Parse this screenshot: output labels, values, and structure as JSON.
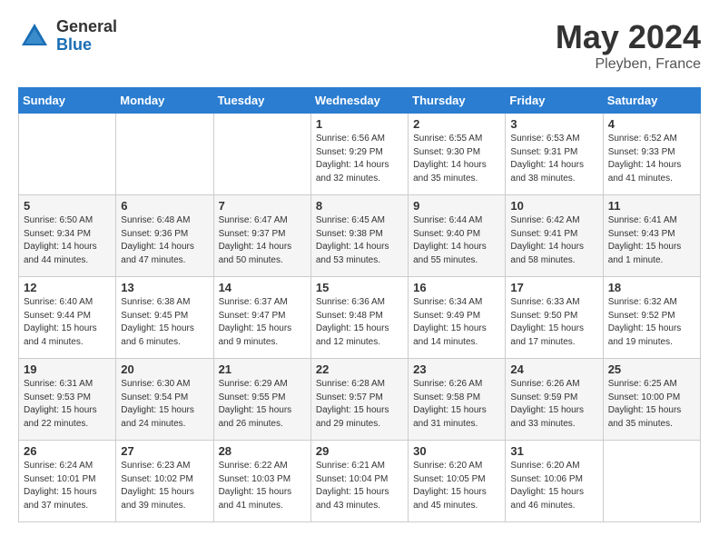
{
  "logo": {
    "general": "General",
    "blue": "Blue"
  },
  "title": {
    "month_year": "May 2024",
    "location": "Pleyben, France"
  },
  "calendar": {
    "headers": [
      "Sunday",
      "Monday",
      "Tuesday",
      "Wednesday",
      "Thursday",
      "Friday",
      "Saturday"
    ],
    "weeks": [
      [
        {
          "day": "",
          "info": ""
        },
        {
          "day": "",
          "info": ""
        },
        {
          "day": "",
          "info": ""
        },
        {
          "day": "1",
          "info": "Sunrise: 6:56 AM\nSunset: 9:29 PM\nDaylight: 14 hours\nand 32 minutes."
        },
        {
          "day": "2",
          "info": "Sunrise: 6:55 AM\nSunset: 9:30 PM\nDaylight: 14 hours\nand 35 minutes."
        },
        {
          "day": "3",
          "info": "Sunrise: 6:53 AM\nSunset: 9:31 PM\nDaylight: 14 hours\nand 38 minutes."
        },
        {
          "day": "4",
          "info": "Sunrise: 6:52 AM\nSunset: 9:33 PM\nDaylight: 14 hours\nand 41 minutes."
        }
      ],
      [
        {
          "day": "5",
          "info": "Sunrise: 6:50 AM\nSunset: 9:34 PM\nDaylight: 14 hours\nand 44 minutes."
        },
        {
          "day": "6",
          "info": "Sunrise: 6:48 AM\nSunset: 9:36 PM\nDaylight: 14 hours\nand 47 minutes."
        },
        {
          "day": "7",
          "info": "Sunrise: 6:47 AM\nSunset: 9:37 PM\nDaylight: 14 hours\nand 50 minutes."
        },
        {
          "day": "8",
          "info": "Sunrise: 6:45 AM\nSunset: 9:38 PM\nDaylight: 14 hours\nand 53 minutes."
        },
        {
          "day": "9",
          "info": "Sunrise: 6:44 AM\nSunset: 9:40 PM\nDaylight: 14 hours\nand 55 minutes."
        },
        {
          "day": "10",
          "info": "Sunrise: 6:42 AM\nSunset: 9:41 PM\nDaylight: 14 hours\nand 58 minutes."
        },
        {
          "day": "11",
          "info": "Sunrise: 6:41 AM\nSunset: 9:43 PM\nDaylight: 15 hours\nand 1 minute."
        }
      ],
      [
        {
          "day": "12",
          "info": "Sunrise: 6:40 AM\nSunset: 9:44 PM\nDaylight: 15 hours\nand 4 minutes."
        },
        {
          "day": "13",
          "info": "Sunrise: 6:38 AM\nSunset: 9:45 PM\nDaylight: 15 hours\nand 6 minutes."
        },
        {
          "day": "14",
          "info": "Sunrise: 6:37 AM\nSunset: 9:47 PM\nDaylight: 15 hours\nand 9 minutes."
        },
        {
          "day": "15",
          "info": "Sunrise: 6:36 AM\nSunset: 9:48 PM\nDaylight: 15 hours\nand 12 minutes."
        },
        {
          "day": "16",
          "info": "Sunrise: 6:34 AM\nSunset: 9:49 PM\nDaylight: 15 hours\nand 14 minutes."
        },
        {
          "day": "17",
          "info": "Sunrise: 6:33 AM\nSunset: 9:50 PM\nDaylight: 15 hours\nand 17 minutes."
        },
        {
          "day": "18",
          "info": "Sunrise: 6:32 AM\nSunset: 9:52 PM\nDaylight: 15 hours\nand 19 minutes."
        }
      ],
      [
        {
          "day": "19",
          "info": "Sunrise: 6:31 AM\nSunset: 9:53 PM\nDaylight: 15 hours\nand 22 minutes."
        },
        {
          "day": "20",
          "info": "Sunrise: 6:30 AM\nSunset: 9:54 PM\nDaylight: 15 hours\nand 24 minutes."
        },
        {
          "day": "21",
          "info": "Sunrise: 6:29 AM\nSunset: 9:55 PM\nDaylight: 15 hours\nand 26 minutes."
        },
        {
          "day": "22",
          "info": "Sunrise: 6:28 AM\nSunset: 9:57 PM\nDaylight: 15 hours\nand 29 minutes."
        },
        {
          "day": "23",
          "info": "Sunrise: 6:26 AM\nSunset: 9:58 PM\nDaylight: 15 hours\nand 31 minutes."
        },
        {
          "day": "24",
          "info": "Sunrise: 6:26 AM\nSunset: 9:59 PM\nDaylight: 15 hours\nand 33 minutes."
        },
        {
          "day": "25",
          "info": "Sunrise: 6:25 AM\nSunset: 10:00 PM\nDaylight: 15 hours\nand 35 minutes."
        }
      ],
      [
        {
          "day": "26",
          "info": "Sunrise: 6:24 AM\nSunset: 10:01 PM\nDaylight: 15 hours\nand 37 minutes."
        },
        {
          "day": "27",
          "info": "Sunrise: 6:23 AM\nSunset: 10:02 PM\nDaylight: 15 hours\nand 39 minutes."
        },
        {
          "day": "28",
          "info": "Sunrise: 6:22 AM\nSunset: 10:03 PM\nDaylight: 15 hours\nand 41 minutes."
        },
        {
          "day": "29",
          "info": "Sunrise: 6:21 AM\nSunset: 10:04 PM\nDaylight: 15 hours\nand 43 minutes."
        },
        {
          "day": "30",
          "info": "Sunrise: 6:20 AM\nSunset: 10:05 PM\nDaylight: 15 hours\nand 45 minutes."
        },
        {
          "day": "31",
          "info": "Sunrise: 6:20 AM\nSunset: 10:06 PM\nDaylight: 15 hours\nand 46 minutes."
        },
        {
          "day": "",
          "info": ""
        }
      ]
    ]
  }
}
